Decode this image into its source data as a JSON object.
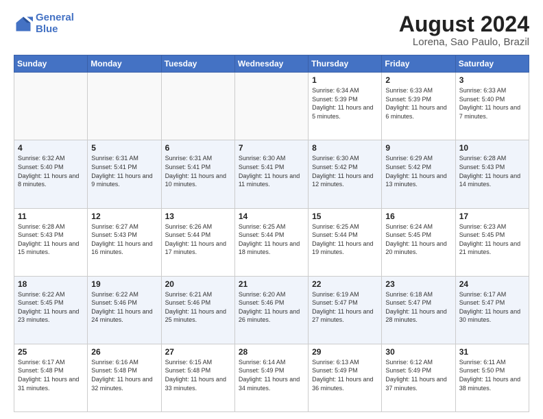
{
  "logo": {
    "line1": "General",
    "line2": "Blue"
  },
  "title": "August 2024",
  "subtitle": "Lorena, Sao Paulo, Brazil",
  "weekdays": [
    "Sunday",
    "Monday",
    "Tuesday",
    "Wednesday",
    "Thursday",
    "Friday",
    "Saturday"
  ],
  "weeks": [
    [
      {
        "num": "",
        "info": ""
      },
      {
        "num": "",
        "info": ""
      },
      {
        "num": "",
        "info": ""
      },
      {
        "num": "",
        "info": ""
      },
      {
        "num": "1",
        "info": "Sunrise: 6:34 AM\nSunset: 5:39 PM\nDaylight: 11 hours\nand 5 minutes."
      },
      {
        "num": "2",
        "info": "Sunrise: 6:33 AM\nSunset: 5:39 PM\nDaylight: 11 hours\nand 6 minutes."
      },
      {
        "num": "3",
        "info": "Sunrise: 6:33 AM\nSunset: 5:40 PM\nDaylight: 11 hours\nand 7 minutes."
      }
    ],
    [
      {
        "num": "4",
        "info": "Sunrise: 6:32 AM\nSunset: 5:40 PM\nDaylight: 11 hours\nand 8 minutes."
      },
      {
        "num": "5",
        "info": "Sunrise: 6:31 AM\nSunset: 5:41 PM\nDaylight: 11 hours\nand 9 minutes."
      },
      {
        "num": "6",
        "info": "Sunrise: 6:31 AM\nSunset: 5:41 PM\nDaylight: 11 hours\nand 10 minutes."
      },
      {
        "num": "7",
        "info": "Sunrise: 6:30 AM\nSunset: 5:41 PM\nDaylight: 11 hours\nand 11 minutes."
      },
      {
        "num": "8",
        "info": "Sunrise: 6:30 AM\nSunset: 5:42 PM\nDaylight: 11 hours\nand 12 minutes."
      },
      {
        "num": "9",
        "info": "Sunrise: 6:29 AM\nSunset: 5:42 PM\nDaylight: 11 hours\nand 13 minutes."
      },
      {
        "num": "10",
        "info": "Sunrise: 6:28 AM\nSunset: 5:43 PM\nDaylight: 11 hours\nand 14 minutes."
      }
    ],
    [
      {
        "num": "11",
        "info": "Sunrise: 6:28 AM\nSunset: 5:43 PM\nDaylight: 11 hours\nand 15 minutes."
      },
      {
        "num": "12",
        "info": "Sunrise: 6:27 AM\nSunset: 5:43 PM\nDaylight: 11 hours\nand 16 minutes."
      },
      {
        "num": "13",
        "info": "Sunrise: 6:26 AM\nSunset: 5:44 PM\nDaylight: 11 hours\nand 17 minutes."
      },
      {
        "num": "14",
        "info": "Sunrise: 6:25 AM\nSunset: 5:44 PM\nDaylight: 11 hours\nand 18 minutes."
      },
      {
        "num": "15",
        "info": "Sunrise: 6:25 AM\nSunset: 5:44 PM\nDaylight: 11 hours\nand 19 minutes."
      },
      {
        "num": "16",
        "info": "Sunrise: 6:24 AM\nSunset: 5:45 PM\nDaylight: 11 hours\nand 20 minutes."
      },
      {
        "num": "17",
        "info": "Sunrise: 6:23 AM\nSunset: 5:45 PM\nDaylight: 11 hours\nand 21 minutes."
      }
    ],
    [
      {
        "num": "18",
        "info": "Sunrise: 6:22 AM\nSunset: 5:45 PM\nDaylight: 11 hours\nand 23 minutes."
      },
      {
        "num": "19",
        "info": "Sunrise: 6:22 AM\nSunset: 5:46 PM\nDaylight: 11 hours\nand 24 minutes."
      },
      {
        "num": "20",
        "info": "Sunrise: 6:21 AM\nSunset: 5:46 PM\nDaylight: 11 hours\nand 25 minutes."
      },
      {
        "num": "21",
        "info": "Sunrise: 6:20 AM\nSunset: 5:46 PM\nDaylight: 11 hours\nand 26 minutes."
      },
      {
        "num": "22",
        "info": "Sunrise: 6:19 AM\nSunset: 5:47 PM\nDaylight: 11 hours\nand 27 minutes."
      },
      {
        "num": "23",
        "info": "Sunrise: 6:18 AM\nSunset: 5:47 PM\nDaylight: 11 hours\nand 28 minutes."
      },
      {
        "num": "24",
        "info": "Sunrise: 6:17 AM\nSunset: 5:47 PM\nDaylight: 11 hours\nand 30 minutes."
      }
    ],
    [
      {
        "num": "25",
        "info": "Sunrise: 6:17 AM\nSunset: 5:48 PM\nDaylight: 11 hours\nand 31 minutes."
      },
      {
        "num": "26",
        "info": "Sunrise: 6:16 AM\nSunset: 5:48 PM\nDaylight: 11 hours\nand 32 minutes."
      },
      {
        "num": "27",
        "info": "Sunrise: 6:15 AM\nSunset: 5:48 PM\nDaylight: 11 hours\nand 33 minutes."
      },
      {
        "num": "28",
        "info": "Sunrise: 6:14 AM\nSunset: 5:49 PM\nDaylight: 11 hours\nand 34 minutes."
      },
      {
        "num": "29",
        "info": "Sunrise: 6:13 AM\nSunset: 5:49 PM\nDaylight: 11 hours\nand 36 minutes."
      },
      {
        "num": "30",
        "info": "Sunrise: 6:12 AM\nSunset: 5:49 PM\nDaylight: 11 hours\nand 37 minutes."
      },
      {
        "num": "31",
        "info": "Sunrise: 6:11 AM\nSunset: 5:50 PM\nDaylight: 11 hours\nand 38 minutes."
      }
    ]
  ]
}
